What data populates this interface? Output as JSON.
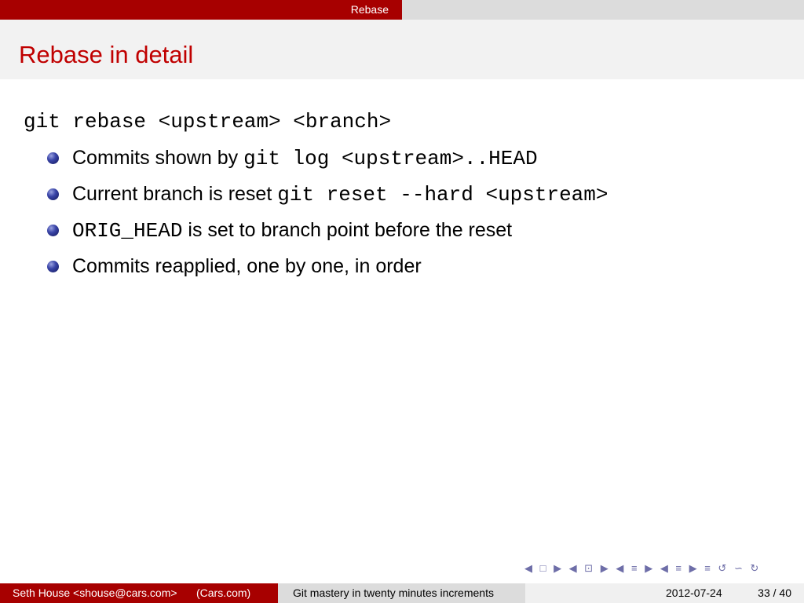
{
  "header": {
    "section": "Rebase"
  },
  "frame": {
    "title": "Rebase in detail",
    "command": "git rebase <upstream> <branch>",
    "bullets": [
      {
        "pre": "Commits shown by ",
        "code": "git log <upstream>..HEAD",
        "post": ""
      },
      {
        "pre": "Current branch is reset ",
        "code": "git reset --hard <upstream>",
        "post": ""
      },
      {
        "pre": "",
        "code": "ORIG_HEAD",
        "post": " is set to branch point before the reset"
      },
      {
        "pre": "Commits reapplied, one by one, in order",
        "code": "",
        "post": ""
      }
    ]
  },
  "nav_symbols": "◀ □ ▶ ◀ ⊡ ▶ ◀ ≡ ▶ ◀ ≡ ▶ ≡ ↺ ∽ ↻",
  "footer": {
    "author": "Seth House <shouse@cars.com>",
    "institute": "(Cars.com)",
    "talk_title": "Git mastery in twenty minutes increments",
    "date": "2012-07-24",
    "page": "33 / 40"
  },
  "colors": {
    "accent": "#a70000",
    "title": "#c00000",
    "bullet": "#2a3590"
  }
}
